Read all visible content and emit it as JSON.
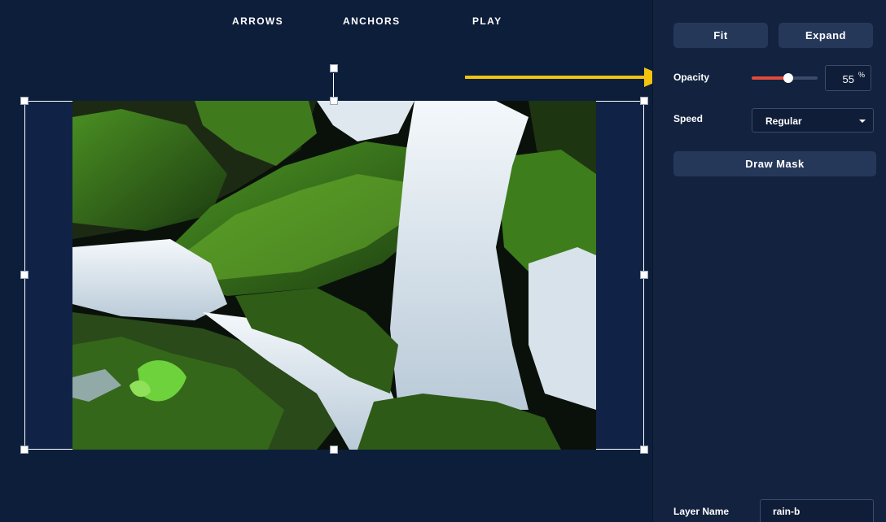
{
  "topnav": {
    "arrows": "ARROWS",
    "anchors": "ANCHORS",
    "play": "PLAY"
  },
  "panel": {
    "fit_label": "Fit",
    "expand_label": "Expand",
    "opacity_label": "Opacity",
    "opacity_value": "55",
    "opacity_unit": "%",
    "opacity_fraction": 0.55,
    "speed_label": "Speed",
    "speed_value": "Regular",
    "draw_mask_label": "Draw Mask",
    "layer_name_label": "Layer Name",
    "layer_name_value": "rain-b"
  },
  "colors": {
    "background": "#0d1e3b",
    "panel": "#12223f",
    "button": "#26385a",
    "slider_fill": "#e24a3b",
    "callout_arrow": "#f2c40f"
  },
  "icons": {
    "dropdown": "chevron-down-icon",
    "callout": "arrow-right-icon"
  }
}
